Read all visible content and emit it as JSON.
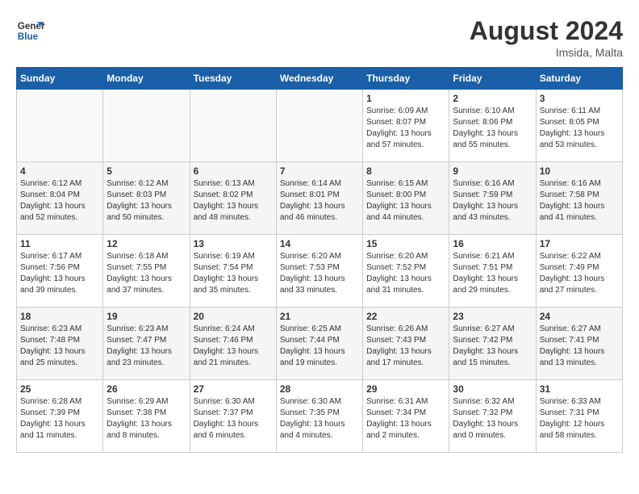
{
  "header": {
    "logo_general": "General",
    "logo_blue": "Blue",
    "month_year": "August 2024",
    "location": "Imsida, Malta"
  },
  "weekdays": [
    "Sunday",
    "Monday",
    "Tuesday",
    "Wednesday",
    "Thursday",
    "Friday",
    "Saturday"
  ],
  "weeks": [
    [
      {
        "day": "",
        "info": ""
      },
      {
        "day": "",
        "info": ""
      },
      {
        "day": "",
        "info": ""
      },
      {
        "day": "",
        "info": ""
      },
      {
        "day": "1",
        "info": "Sunrise: 6:09 AM\nSunset: 8:07 PM\nDaylight: 13 hours\nand 57 minutes."
      },
      {
        "day": "2",
        "info": "Sunrise: 6:10 AM\nSunset: 8:06 PM\nDaylight: 13 hours\nand 55 minutes."
      },
      {
        "day": "3",
        "info": "Sunrise: 6:11 AM\nSunset: 8:05 PM\nDaylight: 13 hours\nand 53 minutes."
      }
    ],
    [
      {
        "day": "4",
        "info": "Sunrise: 6:12 AM\nSunset: 8:04 PM\nDaylight: 13 hours\nand 52 minutes."
      },
      {
        "day": "5",
        "info": "Sunrise: 6:12 AM\nSunset: 8:03 PM\nDaylight: 13 hours\nand 50 minutes."
      },
      {
        "day": "6",
        "info": "Sunrise: 6:13 AM\nSunset: 8:02 PM\nDaylight: 13 hours\nand 48 minutes."
      },
      {
        "day": "7",
        "info": "Sunrise: 6:14 AM\nSunset: 8:01 PM\nDaylight: 13 hours\nand 46 minutes."
      },
      {
        "day": "8",
        "info": "Sunrise: 6:15 AM\nSunset: 8:00 PM\nDaylight: 13 hours\nand 44 minutes."
      },
      {
        "day": "9",
        "info": "Sunrise: 6:16 AM\nSunset: 7:59 PM\nDaylight: 13 hours\nand 43 minutes."
      },
      {
        "day": "10",
        "info": "Sunrise: 6:16 AM\nSunset: 7:58 PM\nDaylight: 13 hours\nand 41 minutes."
      }
    ],
    [
      {
        "day": "11",
        "info": "Sunrise: 6:17 AM\nSunset: 7:56 PM\nDaylight: 13 hours\nand 39 minutes."
      },
      {
        "day": "12",
        "info": "Sunrise: 6:18 AM\nSunset: 7:55 PM\nDaylight: 13 hours\nand 37 minutes."
      },
      {
        "day": "13",
        "info": "Sunrise: 6:19 AM\nSunset: 7:54 PM\nDaylight: 13 hours\nand 35 minutes."
      },
      {
        "day": "14",
        "info": "Sunrise: 6:20 AM\nSunset: 7:53 PM\nDaylight: 13 hours\nand 33 minutes."
      },
      {
        "day": "15",
        "info": "Sunrise: 6:20 AM\nSunset: 7:52 PM\nDaylight: 13 hours\nand 31 minutes."
      },
      {
        "day": "16",
        "info": "Sunrise: 6:21 AM\nSunset: 7:51 PM\nDaylight: 13 hours\nand 29 minutes."
      },
      {
        "day": "17",
        "info": "Sunrise: 6:22 AM\nSunset: 7:49 PM\nDaylight: 13 hours\nand 27 minutes."
      }
    ],
    [
      {
        "day": "18",
        "info": "Sunrise: 6:23 AM\nSunset: 7:48 PM\nDaylight: 13 hours\nand 25 minutes."
      },
      {
        "day": "19",
        "info": "Sunrise: 6:23 AM\nSunset: 7:47 PM\nDaylight: 13 hours\nand 23 minutes."
      },
      {
        "day": "20",
        "info": "Sunrise: 6:24 AM\nSunset: 7:46 PM\nDaylight: 13 hours\nand 21 minutes."
      },
      {
        "day": "21",
        "info": "Sunrise: 6:25 AM\nSunset: 7:44 PM\nDaylight: 13 hours\nand 19 minutes."
      },
      {
        "day": "22",
        "info": "Sunrise: 6:26 AM\nSunset: 7:43 PM\nDaylight: 13 hours\nand 17 minutes."
      },
      {
        "day": "23",
        "info": "Sunrise: 6:27 AM\nSunset: 7:42 PM\nDaylight: 13 hours\nand 15 minutes."
      },
      {
        "day": "24",
        "info": "Sunrise: 6:27 AM\nSunset: 7:41 PM\nDaylight: 13 hours\nand 13 minutes."
      }
    ],
    [
      {
        "day": "25",
        "info": "Sunrise: 6:28 AM\nSunset: 7:39 PM\nDaylight: 13 hours\nand 11 minutes."
      },
      {
        "day": "26",
        "info": "Sunrise: 6:29 AM\nSunset: 7:38 PM\nDaylight: 13 hours\nand 8 minutes."
      },
      {
        "day": "27",
        "info": "Sunrise: 6:30 AM\nSunset: 7:37 PM\nDaylight: 13 hours\nand 6 minutes."
      },
      {
        "day": "28",
        "info": "Sunrise: 6:30 AM\nSunset: 7:35 PM\nDaylight: 13 hours\nand 4 minutes."
      },
      {
        "day": "29",
        "info": "Sunrise: 6:31 AM\nSunset: 7:34 PM\nDaylight: 13 hours\nand 2 minutes."
      },
      {
        "day": "30",
        "info": "Sunrise: 6:32 AM\nSunset: 7:32 PM\nDaylight: 13 hours\nand 0 minutes."
      },
      {
        "day": "31",
        "info": "Sunrise: 6:33 AM\nSunset: 7:31 PM\nDaylight: 12 hours\nand 58 minutes."
      }
    ]
  ]
}
